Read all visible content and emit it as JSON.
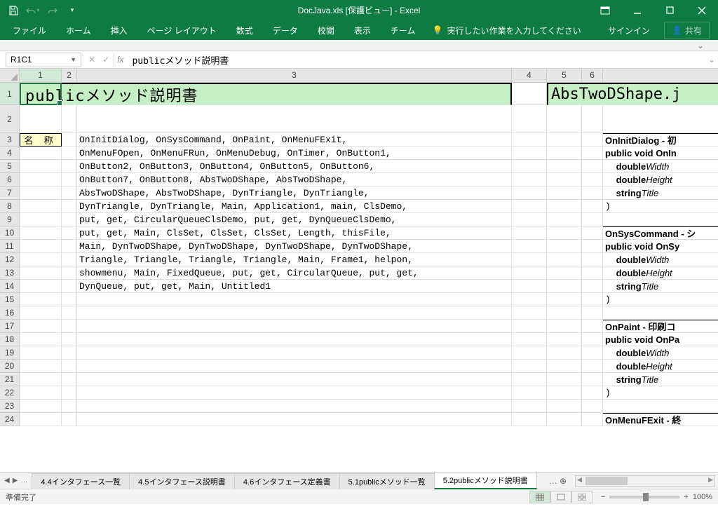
{
  "title": "DocJava.xls  [保護ビュー]  -  Excel",
  "qat": {
    "save": "保存",
    "undo": "元に戻す",
    "redo": "やり直し"
  },
  "tabs": {
    "file": "ファイル",
    "home": "ホーム",
    "insert": "挿入",
    "pageLayout": "ページ レイアウト",
    "formulas": "数式",
    "data": "データ",
    "review": "校閲",
    "view": "表示",
    "team": "チーム"
  },
  "tellMe": "実行したい作業を入力してください",
  "signIn": "サインイン",
  "share": "共有",
  "nameBox": "R1C1",
  "formula": "publicメソッド説明書",
  "columns": [
    "1",
    "2",
    "3",
    "4",
    "5",
    "6"
  ],
  "mergedTitle": "publicメソッド説明書",
  "rightTitle": "AbsTwoDShape.j",
  "nameHeader": "名 称",
  "methodLines": [
    "OnInitDialog, OnSysCommand, OnPaint, OnMenuFExit,",
    "OnMenuFOpen, OnMenuFRun, OnMenuDebug, OnTimer, OnButton1,",
    "OnButton2, OnButton3, OnButton4, OnButton5, OnButton6,",
    "OnButton7, OnButton8, AbsTwoDShape, AbsTwoDShape,",
    "AbsTwoDShape, AbsTwoDShape, DynTriangle, DynTriangle,",
    "DynTriangle, DynTriangle, Main, Application1, main, ClsDemo,",
    "put, get, CircularQueueClsDemo, put, get, DynQueueClsDemo,",
    "put, get, Main, ClsSet, ClsSet, ClsSet, Length, thisFile,",
    "Main, DynTwoDShape, DynTwoDShape, DynTwoDShape, DynTwoDShape,",
    "Triangle, Triangle, Triangle, Triangle, Main, Frame1, helpon,",
    "showmenu, Main, FixedQueue, put, get, CircularQueue, put, get,",
    "DynQueue, put, get, Main, Untitled1"
  ],
  "rightBlocks": [
    {
      "hdr": "OnInitDialog - 初",
      "sig": "public void OnIn",
      "p1": "double",
      "p1v": "Width",
      "p2": "double",
      "p2v": "Height",
      "p3": "string",
      "p3v": "Title",
      "close": ")"
    },
    {
      "hdr": "OnSysCommand - シ",
      "sig": "public void OnSy",
      "p1": "double",
      "p1v": "Width",
      "p2": "double",
      "p2v": "Height",
      "p3": "string",
      "p3v": "Title",
      "close": ")"
    },
    {
      "hdr": "OnPaint  - 印刷コ",
      "sig": "public void OnPa",
      "p1": "double",
      "p1v": "Width",
      "p2": "double",
      "p2v": "Height",
      "p3": "string",
      "p3v": "Title",
      "close": ")"
    },
    {
      "hdr": "OnMenuFExit - 終",
      "sig": "",
      "p1": "",
      "p1v": "",
      "p2": "",
      "p2v": "",
      "p3": "",
      "p3v": "",
      "close": ""
    }
  ],
  "sheetTabs": [
    "4.4インタフェース一覧",
    "4.5インタフェース説明書",
    "4.6インタフェース定義書",
    "5.1publicメソッド一覧",
    "5.2publicメソッド説明書"
  ],
  "activeTab": 4,
  "status": "準備完了",
  "zoom": "100%"
}
